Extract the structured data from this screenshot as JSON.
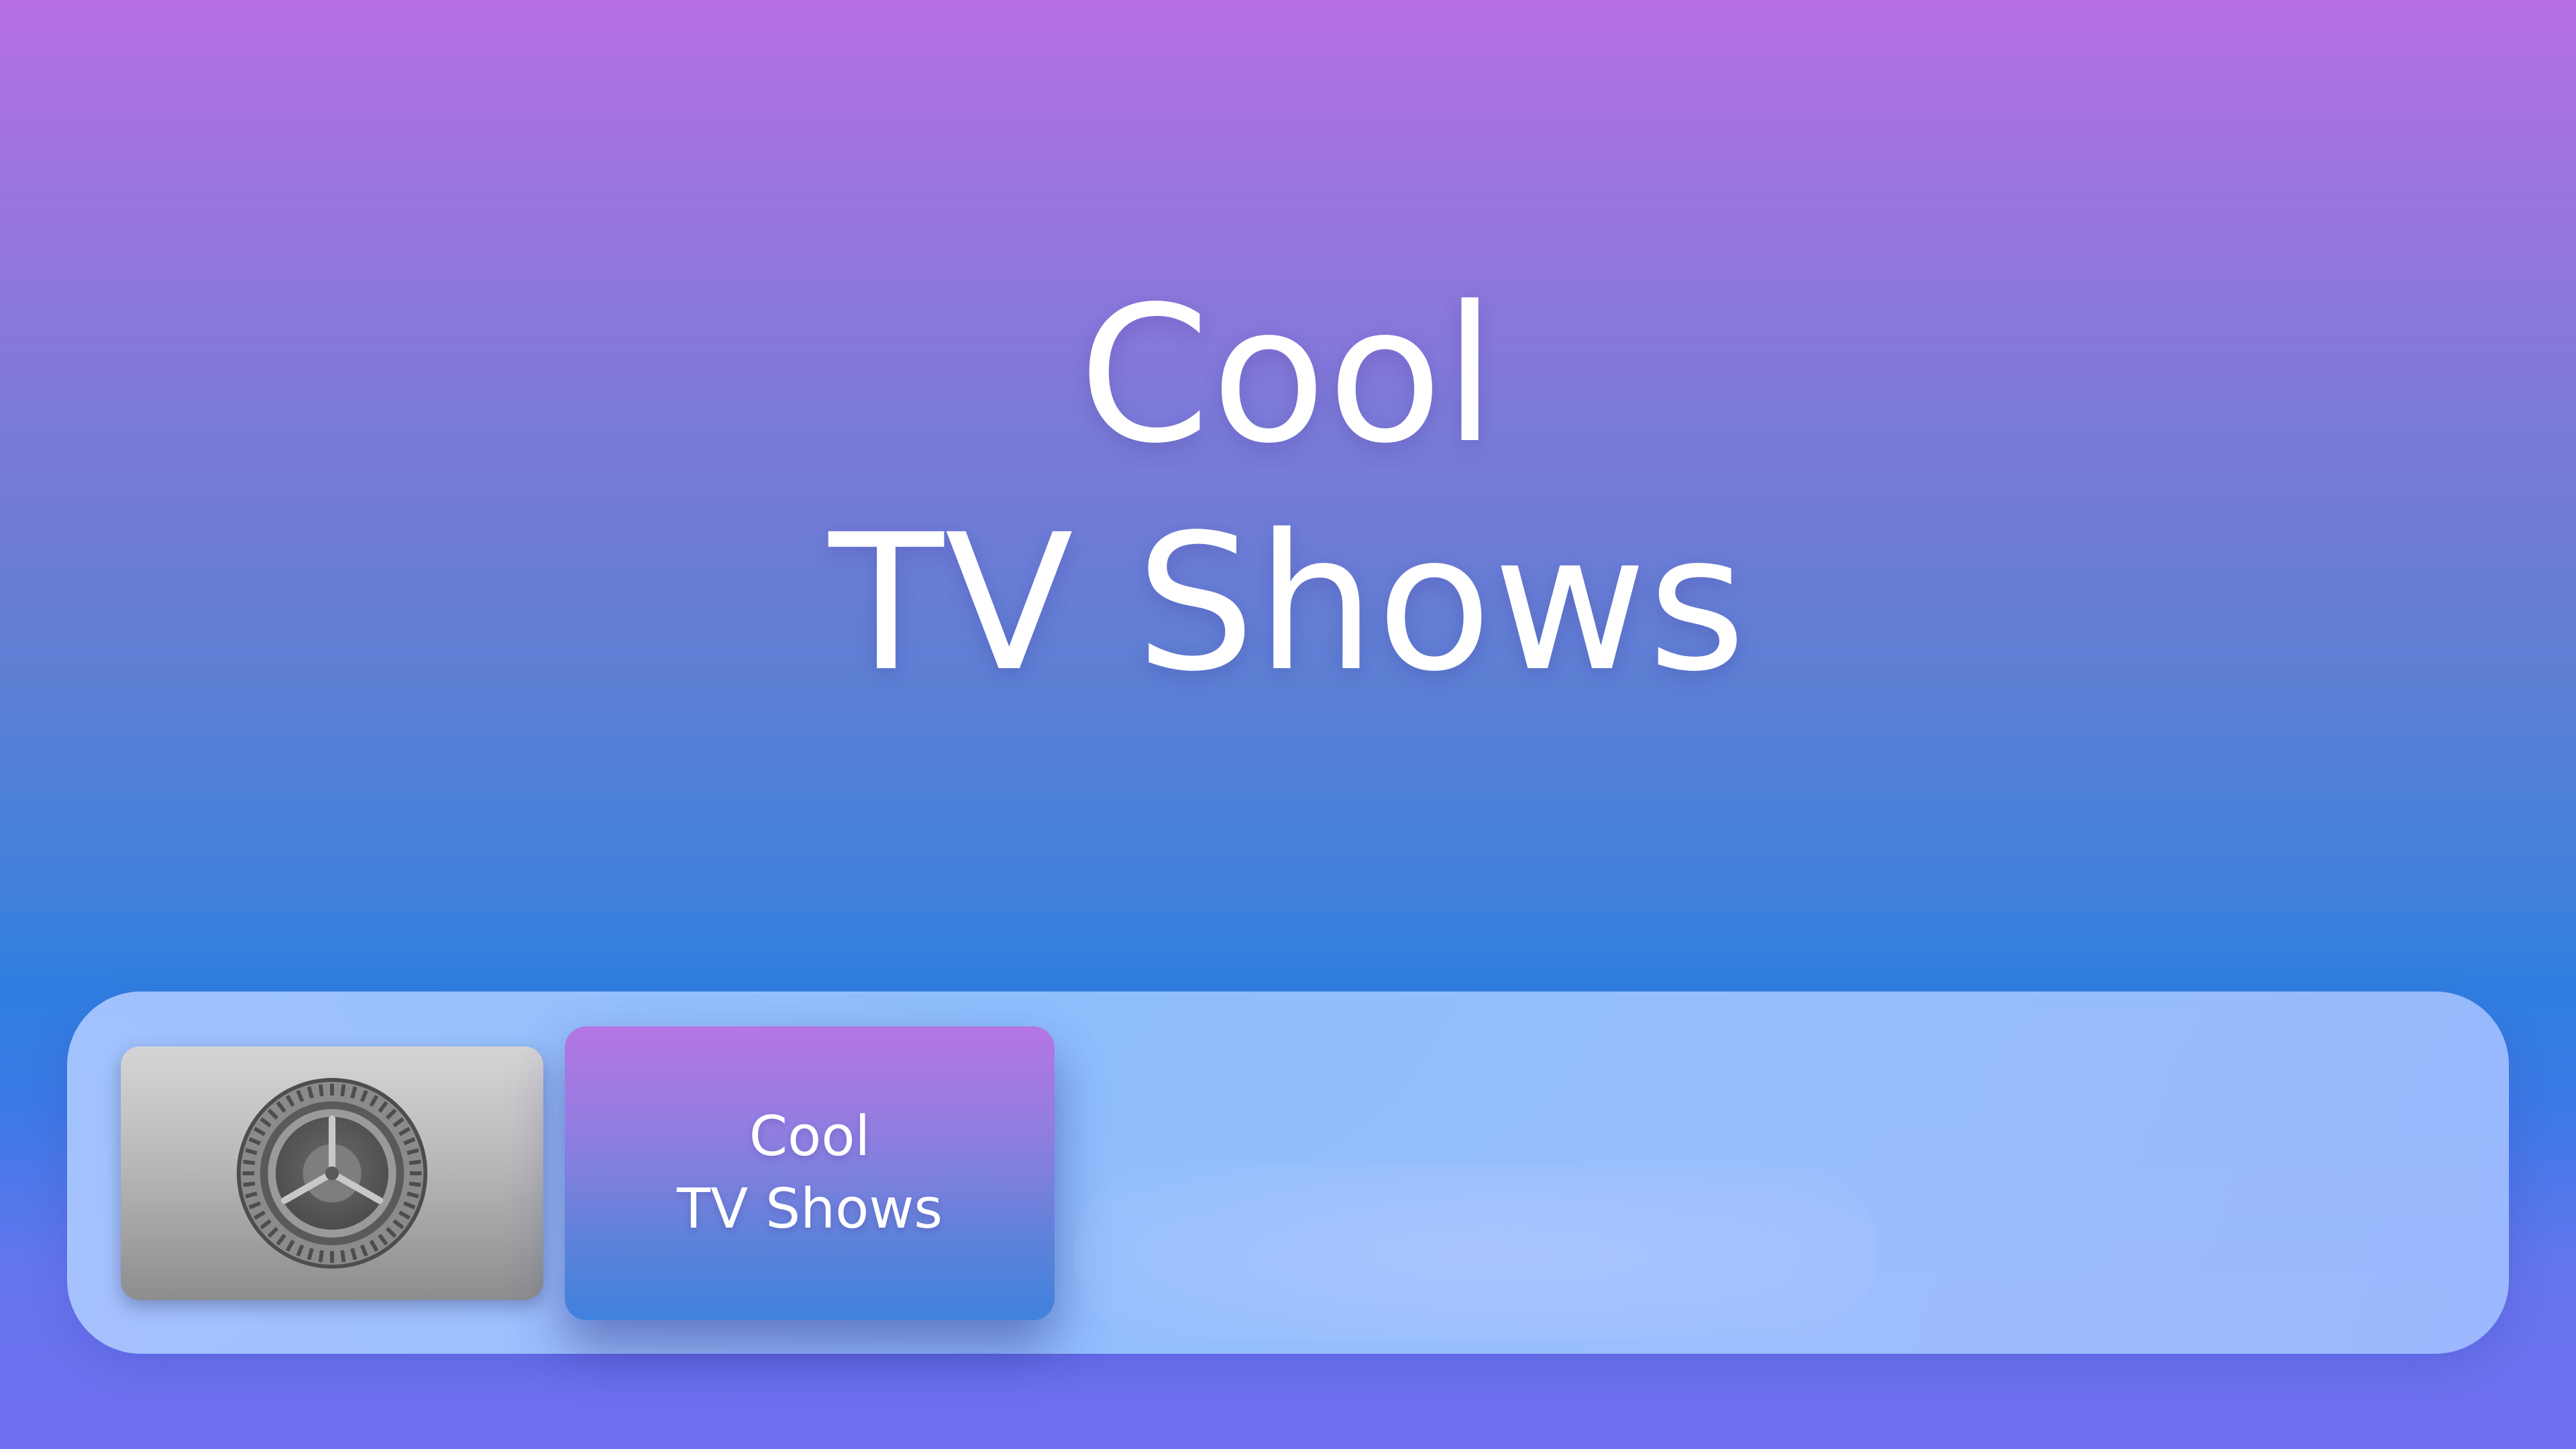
{
  "hero": {
    "title_line1": "Cool",
    "title_line2": "TV Shows"
  },
  "dock": {
    "apps": [
      {
        "name": "Settings",
        "icon": "settings-gear-icon"
      },
      {
        "label_line1": "Cool",
        "label_line2": "TV Shows",
        "focused": true
      }
    ]
  },
  "colors": {
    "background_top": "#b66ee6",
    "background_mid": "#2f7fe0",
    "background_bottom": "#706ff0",
    "dock": "#9fc4ff",
    "text": "#ffffff"
  }
}
